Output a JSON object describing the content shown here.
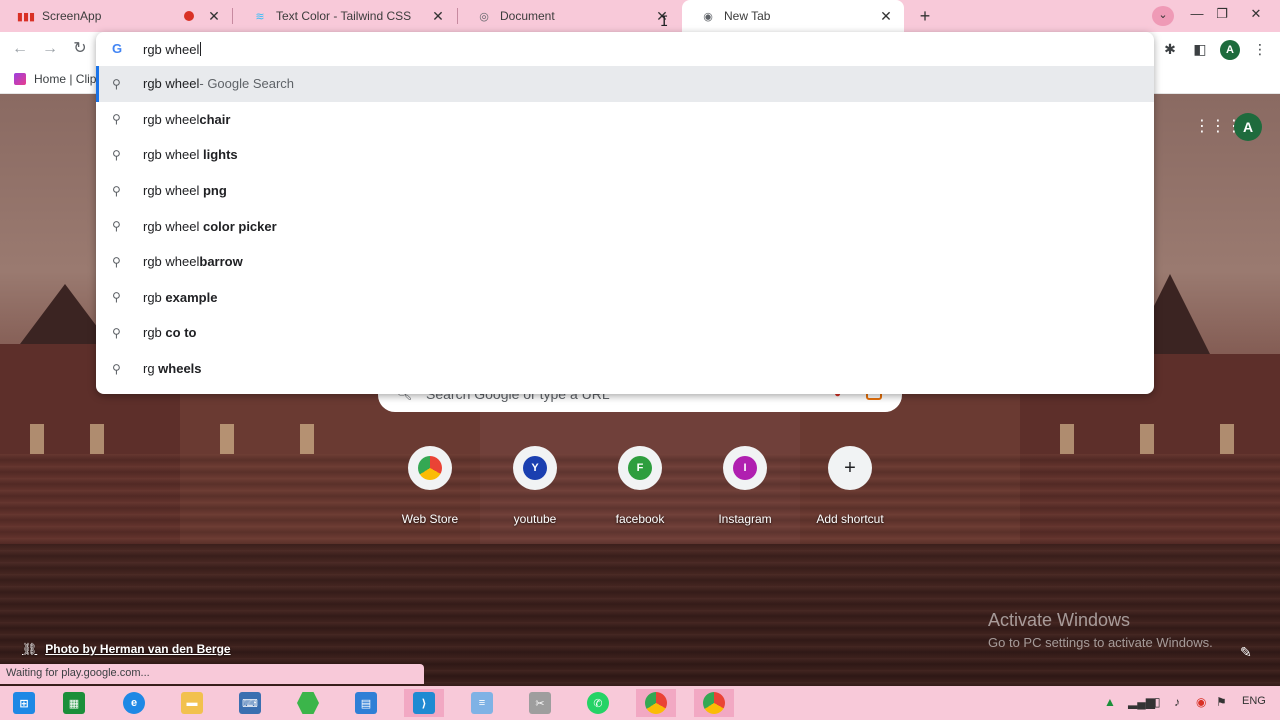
{
  "tabs": [
    {
      "title": "ScreenApp",
      "recording": true
    },
    {
      "title": "Text Color - Tailwind CSS"
    },
    {
      "title": "Document"
    },
    {
      "title": "New Tab",
      "active": true
    }
  ],
  "bookmarks": [
    {
      "label": "Home | Clip"
    }
  ],
  "omnibox": {
    "query": "rgb wheel",
    "suggestions": [
      {
        "prefix": "rgb wheel",
        "bold": "",
        "hint": " - Google Search"
      },
      {
        "prefix": "rgb wheel",
        "bold": "chair",
        "hint": ""
      },
      {
        "prefix": "rgb wheel ",
        "bold": "lights",
        "hint": ""
      },
      {
        "prefix": "rgb wheel ",
        "bold": "png",
        "hint": ""
      },
      {
        "prefix": "rgb wheel ",
        "bold": "color picker",
        "hint": ""
      },
      {
        "prefix": "rgb wheel",
        "bold": "barrow",
        "hint": ""
      },
      {
        "prefix": "rgb ",
        "bold": "example",
        "hint": ""
      },
      {
        "prefix": "rgb ",
        "bold": "co to",
        "hint": ""
      },
      {
        "prefix": "rg",
        "bold": " wheels",
        "hint": ""
      }
    ]
  },
  "profile_initial": "A",
  "ntp": {
    "search_placeholder": "Search Google or type a URL",
    "shortcuts": [
      {
        "label": "Web Store",
        "letter": "",
        "color": "#ffffff"
      },
      {
        "label": "youtube",
        "letter": "Y",
        "color": "#1a3fb0"
      },
      {
        "label": "facebook",
        "letter": "F",
        "color": "#2e9e3e"
      },
      {
        "label": "Instagram",
        "letter": "I",
        "color": "#b01fb0"
      },
      {
        "label": "Add shortcut",
        "letter": "+",
        "color": "#f1f3f4"
      }
    ],
    "photo_credit": "Photo by Herman van den Berge"
  },
  "status_text": "Waiting for play.google.com...",
  "watermark": {
    "line1": "Activate Windows",
    "line2": "Go to PC settings to activate Windows."
  },
  "tray": {
    "language": "ENG"
  },
  "colors": {
    "tabstrip": "#f8c9d9",
    "accent": "#1a73e8",
    "record": "#d93025"
  }
}
